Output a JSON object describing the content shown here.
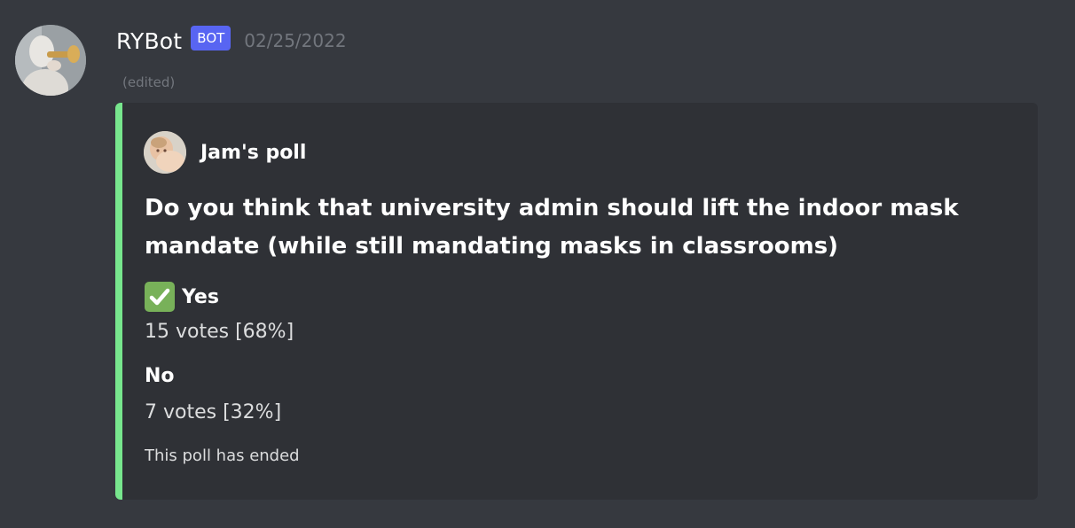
{
  "message": {
    "username": "RYBot",
    "bot_tag": "BOT",
    "timestamp": "02/25/2022",
    "edited": "(edited)"
  },
  "embed": {
    "accent_color": "#77e68d",
    "author": "Jam's poll",
    "title": "Do you think that university admin should lift the indoor mask mandate (while still mandating masks in classrooms)",
    "options": [
      {
        "emoji": "check-mark-icon",
        "name": "Yes",
        "votes": "15 votes [68%]"
      },
      {
        "emoji": "",
        "name": "No",
        "votes": "7 votes [32%]"
      }
    ],
    "footer": "This poll has ended"
  },
  "colors": {
    "background": "#36393f",
    "embed_background": "#2f3136",
    "bot_tag": "#5865f2"
  }
}
